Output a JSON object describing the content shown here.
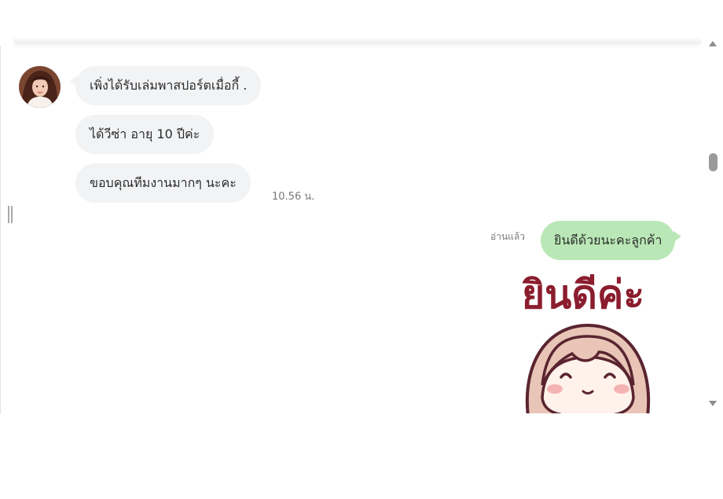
{
  "messages_in": [
    {
      "text": "เพิ่งได้รับเล่มพาสปอร์ตเมื่อกี้ ."
    },
    {
      "text": "ได้วีซ่า อายุ 10 ปีค่ะ"
    },
    {
      "text": "ขอบคุณทีมงานมากๆ นะคะ"
    }
  ],
  "incoming_time": "10.56 น.",
  "outgoing": {
    "read_status": "อ่านแล้ว",
    "text": "ยินดีด้วยนะคะลูกค้า"
  },
  "sticker": {
    "text": "ยินดีค่ะ",
    "text_color": "#8b1d2e"
  },
  "colors": {
    "incoming_bubble": "#f2f3f5",
    "outgoing_bubble": "#b9e8b6"
  },
  "icons": {
    "scroll_up": "triangle-up-icon",
    "scroll_down": "triangle-down-icon",
    "resize_handle": "double-bar-icon"
  }
}
